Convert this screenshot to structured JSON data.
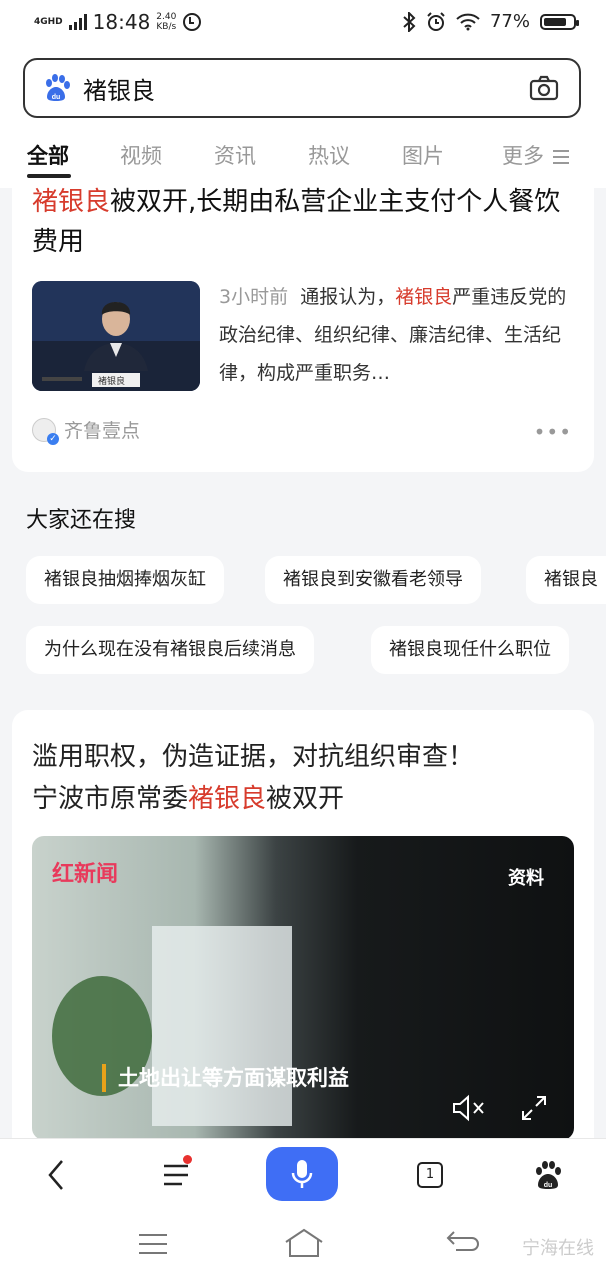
{
  "status": {
    "network": "4GHD",
    "time": "18:48",
    "speed_value": "2.40",
    "speed_unit": "KB/s",
    "battery": "77%"
  },
  "search": {
    "query": "褚银良"
  },
  "tabs": [
    {
      "label": "全部",
      "active": true
    },
    {
      "label": "视频"
    },
    {
      "label": "资讯"
    },
    {
      "label": "热议"
    },
    {
      "label": "图片"
    },
    {
      "label": "更多"
    }
  ],
  "card1": {
    "title_highlight": "褚银良",
    "title_rest": "被双开,长期由私营企业主支付个人餐饮费用",
    "time": "3小时前",
    "snippet_pre": "通报认为，",
    "snippet_highlight": "褚银良",
    "snippet_post": "严重违反党的政治纪律、组织纪律、廉洁纪律、生活纪律，构成严重职务…",
    "source": "齐鲁壹点",
    "thumb_caption": "褚银良"
  },
  "also_search": {
    "heading": "大家还在搜",
    "chips": [
      "褚银良抽烟捧烟灰缸",
      "褚银良到安徽看老领导",
      "褚银良",
      "为什么现在没有褚银良后续消息",
      "褚银良现任什么职位"
    ]
  },
  "card2": {
    "title_line1": "滥用职权，伪造证据，对抗组织审查！",
    "title_line2_pre": "宁波市原常委",
    "title_line2_highlight": "褚银良",
    "title_line2_post": "被双开",
    "video_logo": "红新闻",
    "video_tag": "资料",
    "video_subtitle": "土地出让等方面谋取利益"
  },
  "toolbar": {
    "tab_count": "1"
  },
  "watermark": "宁海在线",
  "colors": {
    "highlight": "#d73b2c",
    "accent": "#3f6ef5"
  }
}
